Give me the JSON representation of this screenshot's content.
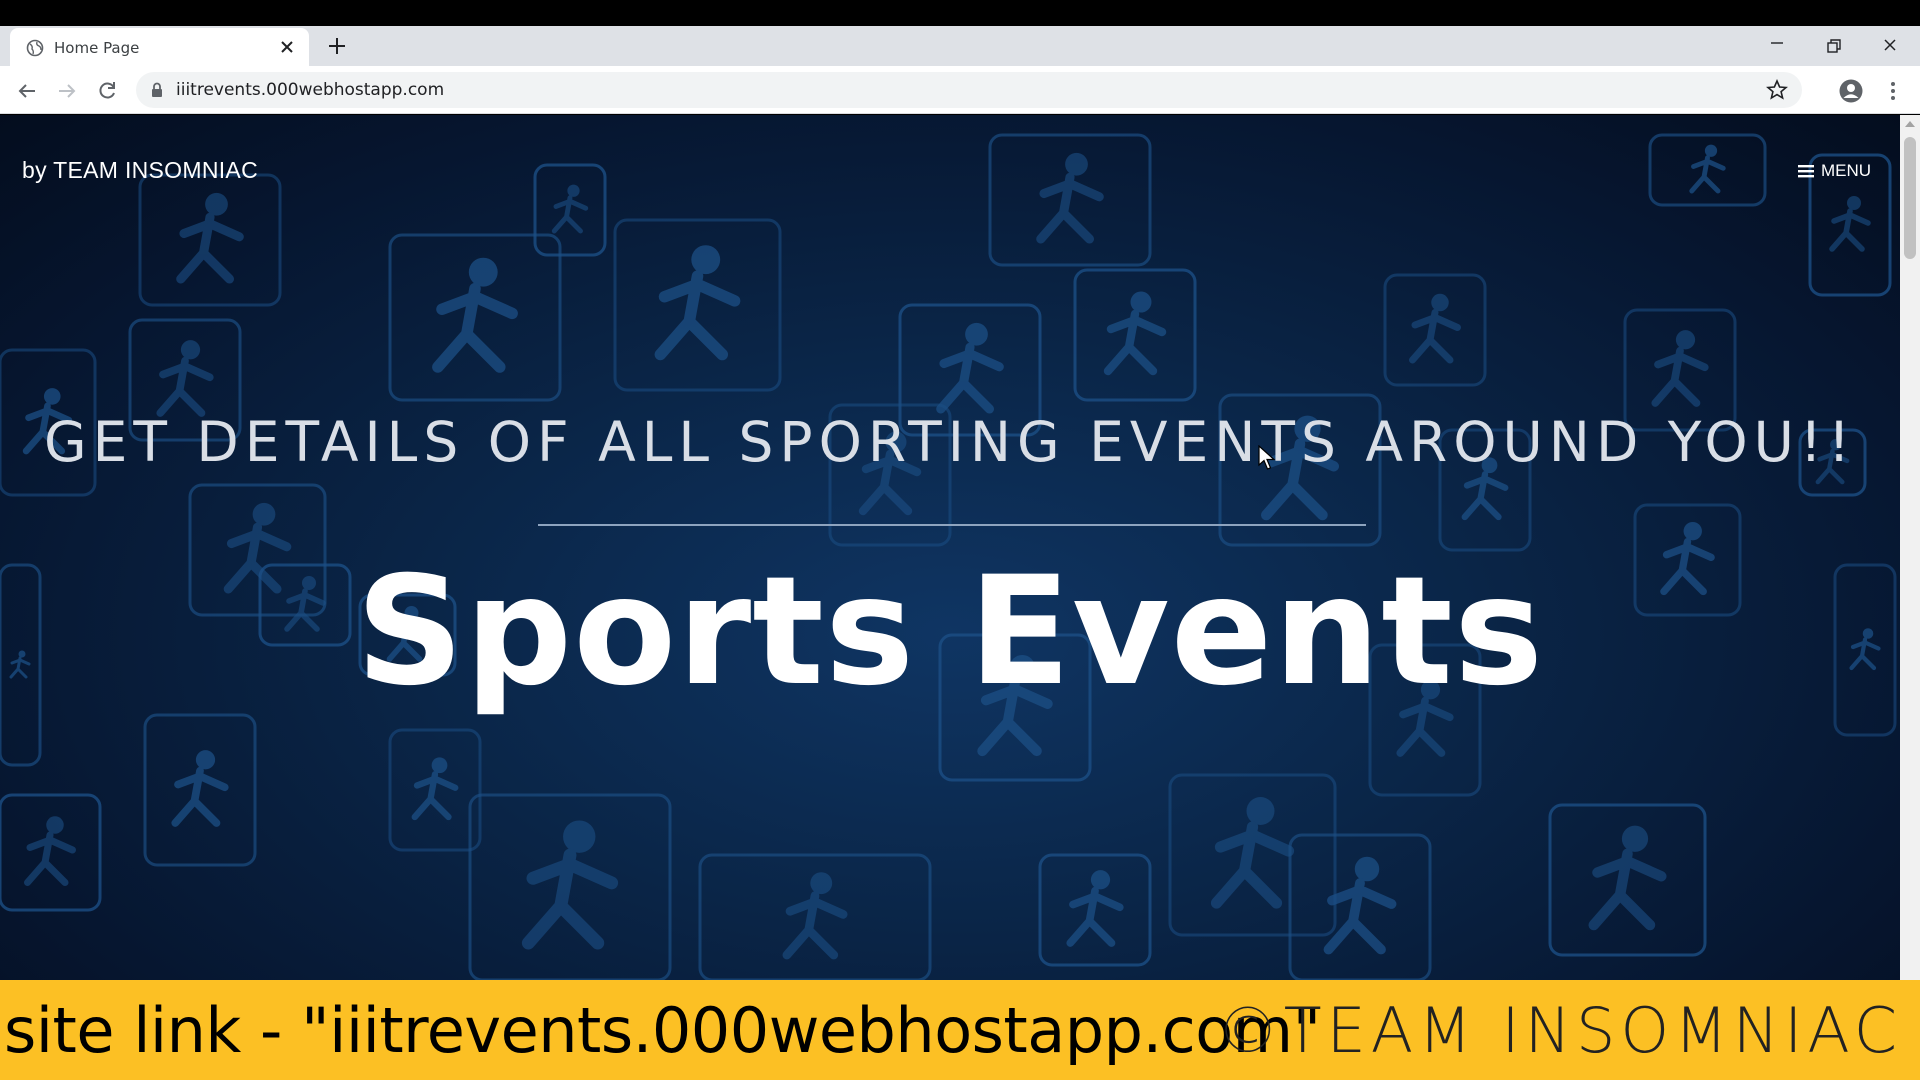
{
  "browser": {
    "tab_title": "Home Page",
    "url": "iiitrevents.000webhostapp.com"
  },
  "page": {
    "brand": "by TEAM INSOMNIAC",
    "menu_label": "MENU",
    "tagline": "GET DETAILS OF ALL SPORTING EVENTS AROUND YOU!!",
    "title": "Sports Events"
  },
  "footer": {
    "site_link": "site link - \"iiitrevents.000webhostapp.com\"",
    "copyright": "©TEAM INSOMNIAC"
  },
  "colors": {
    "footer_bg": "#fcc024",
    "hero_bg": "#0a2547",
    "icon_tile": "#1c4f85"
  }
}
